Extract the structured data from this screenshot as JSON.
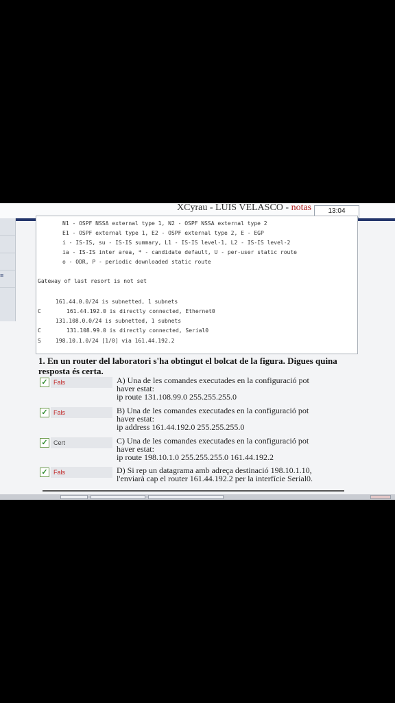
{
  "header": {
    "title_main": "XCyrau - LUIS VELASCO - ",
    "title_accent": "notas",
    "clock": "13:04"
  },
  "left_panel": {
    "glyph": "≡"
  },
  "dump": {
    "lines": [
      "N1 - OSPF NSSA external type 1, N2 - OSPF NSSA external type 2",
      "E1 - OSPF external type 1, E2 - OSPF external type 2, E - EGP",
      "i - IS-IS, su - IS-IS summary, L1 - IS-IS level-1, L2 - IS-IS level-2",
      "ia - IS-IS inter area, * - candidate default, U - per-user static route",
      "o - ODR, P - periodic downloaded static route",
      "Gateway of last resort is not set",
      "161.44.0.0/24 is subnetted, 1 subnets",
      "161.44.192.0 is directly connected, Ethernet0",
      "131.108.0.0/24 is subnetted, 1 subnets",
      "131.108.99.0 is directly connected, Serial0",
      "198.10.1.0/24 [1/0] via 161.44.192.2"
    ],
    "codes": [
      "C",
      "C",
      "S"
    ]
  },
  "question": {
    "text": "1. En un router del laboratori s'ha obtingut el bolcat de la figura. Digues quina resposta és certa."
  },
  "answers": [
    {
      "badge": "Fals",
      "line1": "A) Una de les comandes executades en la configuració pot",
      "line2": "haver estat:",
      "line3": "ip route 131.108.99.0 255.255.255.0"
    },
    {
      "badge": "Fals",
      "line1": "B) Una de les comandes executades en la configuració pot",
      "line2": "haver estat:",
      "line3": "ip address 161.44.192.0 255.255.255.0"
    },
    {
      "badge": "Cert",
      "line1": "C) Una de les comandes executades en la configuració pot",
      "line2": "haver estat:",
      "line3": "ip route 198.10.1.0 255.255.255.0 161.44.192.2"
    },
    {
      "badge": "Fals",
      "line1": "D) Si rep un datagrama amb adreça destinació 198.10.1.10,",
      "line2": "l'enviarà cap el router 161.44.192.2 per la interfície Serial0.",
      "line3": ""
    }
  ],
  "checkmark": "✓",
  "colors": {
    "header_bar": "#23356b",
    "fals": "#c02020",
    "check": "#2e8b2e"
  }
}
